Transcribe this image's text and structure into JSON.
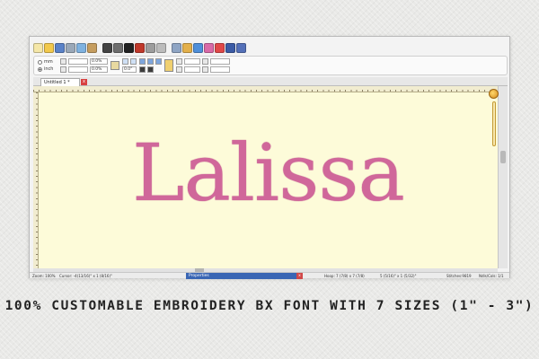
{
  "toolbar": {
    "icons": [
      {
        "name": "new-file-icon",
        "color": "#f5e7a8"
      },
      {
        "name": "open-folder-icon",
        "color": "#f2c94c"
      },
      {
        "name": "save-icon",
        "color": "#5a82c8"
      },
      {
        "name": "print-preview-icon",
        "color": "#9aa8b8"
      },
      {
        "name": "copy-icon",
        "color": "#7fb2e0"
      },
      {
        "name": "paste-icon",
        "color": "#c59d5f"
      },
      {
        "name": "font-icon",
        "color": "#444444"
      },
      {
        "name": "design-icon",
        "color": "#6e6e6e"
      },
      {
        "name": "3d-icon",
        "color": "#222222"
      },
      {
        "name": "color-palette-icon",
        "color": "#c0392b"
      },
      {
        "name": "zoom-icon",
        "color": "#9d9d9d"
      },
      {
        "name": "measure-icon",
        "color": "#bcbcbc"
      },
      {
        "name": "airplane-icon",
        "color": "#8fa5c4"
      },
      {
        "name": "grid-icon",
        "color": "#e3b04b"
      },
      {
        "name": "stitch-icon",
        "color": "#4f8fd9"
      },
      {
        "name": "hoop-icon",
        "color": "#d96aa7"
      },
      {
        "name": "record-icon",
        "color": "#e04848"
      },
      {
        "name": "text-a-icon",
        "color": "#3b5ba5"
      },
      {
        "name": "sheet-icon",
        "color": "#5470b8"
      }
    ],
    "units": {
      "mm_label": "mm",
      "inch_label": "inch",
      "selected": "inch"
    },
    "field_pct_top": "0.0%",
    "field_pct_bottom": "0.0%",
    "field_angle": "0.0°"
  },
  "tab": {
    "label": "Untitled 1 *",
    "close_glyph": "x"
  },
  "canvas": {
    "design_text": "Lalissa",
    "thread_color": "#d0679a",
    "background": "#fdfbd9"
  },
  "status": {
    "zoom": "Zoom: 100%",
    "cursor": "Cursor: -4(13/16)\" x 1 (8/16)\"",
    "properties_label": "Properties",
    "properties_close": "x",
    "hoop": "Hoop: 7 (7/8) x 7 (7/8)",
    "size": "5 (5/16)\" x 1 (5/32)\"",
    "stitches": "Stitches:9819",
    "ndls": "Ndls/Cols: 1/1"
  },
  "caption": "100% CUSTOMABLE EMBROIDERY BX FONT WITH 7 SIZES (1\" - 3\")"
}
